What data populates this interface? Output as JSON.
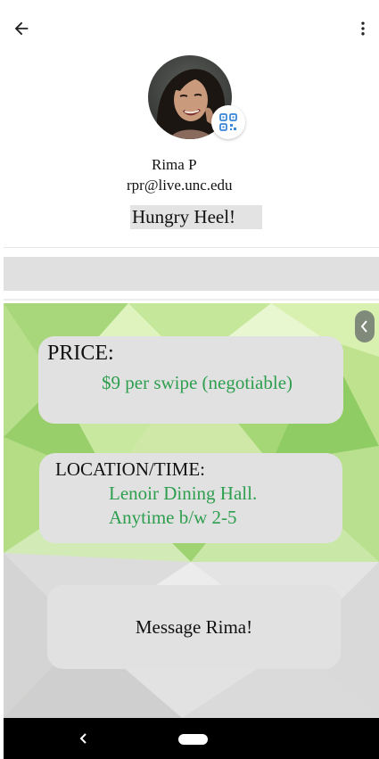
{
  "header": {
    "back_icon": "arrow-left-icon",
    "menu_icon": "more-vert-icon"
  },
  "profile": {
    "avatar_icon": "profile-photo",
    "qr_icon": "qr-code-icon",
    "name": "Rima P",
    "email": "rpr@live.unc.edu",
    "tagline": "Hungry Heel!"
  },
  "listing": {
    "collapse_icon": "chevron-left-icon",
    "price_label": "PRICE:",
    "price_value": "$9 per swipe (negotiable)",
    "location_label": "LOCATION/TIME:",
    "location_line1": "Lenoir Dining Hall.",
    "location_line2": "Anytime b/w 2-5",
    "message_button": "Message Rima!"
  },
  "colors": {
    "accent_green": "#2e9e4f",
    "card_gray": "#e1e1e1"
  },
  "system_nav": {
    "back_icon": "nav-back-icon",
    "home_icon": "nav-home-pill"
  }
}
